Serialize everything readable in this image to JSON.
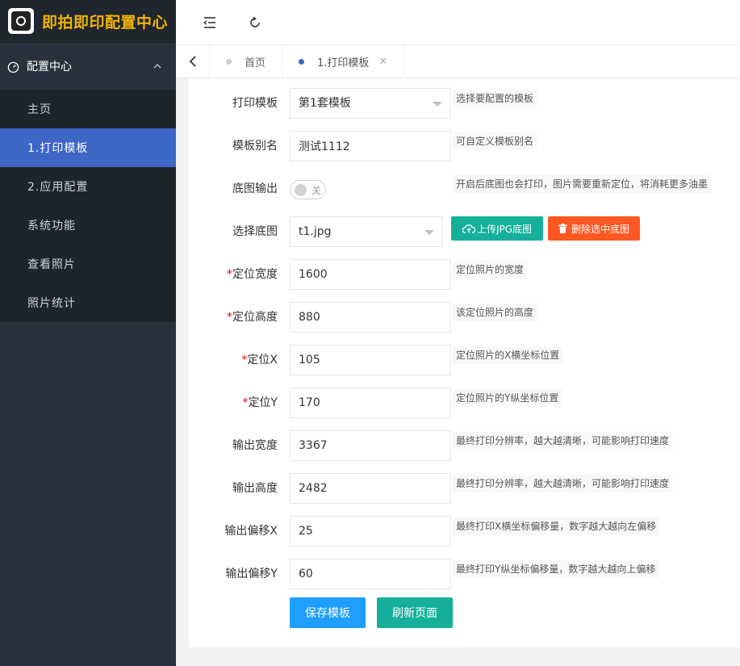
{
  "app": {
    "title": "即拍即印配置中心"
  },
  "sidebar": {
    "group_label": "配置中心",
    "items": [
      {
        "label": "主页",
        "active": false
      },
      {
        "label": "1.打印模板",
        "active": true
      },
      {
        "label": "2.应用配置",
        "active": false
      },
      {
        "label": "系统功能",
        "active": false
      },
      {
        "label": "查看照片",
        "active": false
      },
      {
        "label": "照片统计",
        "active": false
      }
    ]
  },
  "tabs": [
    {
      "label": "首页",
      "active": false
    },
    {
      "label": "1.打印模板",
      "active": true
    }
  ],
  "form": {
    "template": {
      "label": "打印模板",
      "value": "第1套模板",
      "hint": "选择要配置的模板"
    },
    "alias": {
      "label": "模板别名",
      "value": "测试1112",
      "hint": "可自定义模板别名"
    },
    "bg_output": {
      "label": "底图输出",
      "switch_text": "关",
      "hint": "开启后底图也会打印，图片需要重新定位，将消耗更多油墨"
    },
    "bg_image": {
      "label": "选择底图",
      "value": "t1.jpg",
      "upload_label": "上传JPG底图",
      "delete_label": "删除选中底图"
    },
    "pos_width": {
      "label": "定位宽度",
      "value": "1600",
      "hint": "定位照片的宽度"
    },
    "pos_height": {
      "label": "定位高度",
      "value": "880",
      "hint": "该定位照片的高度"
    },
    "pos_x": {
      "label": "定位X",
      "value": "105",
      "hint": "定位照片的X横坐标位置"
    },
    "pos_y": {
      "label": "定位Y",
      "value": "170",
      "hint": "定位照片的Y纵坐标位置"
    },
    "out_width": {
      "label": "输出宽度",
      "value": "3367",
      "hint": "最终打印分辨率，越大越清晰，可能影响打印速度"
    },
    "out_height": {
      "label": "输出高度",
      "value": "2482",
      "hint": "最终打印分辨率，越大越清晰，可能影响打印速度"
    },
    "out_offset_x": {
      "label": "输出偏移X",
      "value": "25",
      "hint": "最终打印X横坐标偏移量，数字越大越向左偏移"
    },
    "out_offset_y": {
      "label": "输出偏移Y",
      "value": "60",
      "hint": "最终打印Y纵坐标偏移量，数字越大越向上偏移"
    },
    "required_mark": "*",
    "save_label": "保存模板",
    "refresh_label": "刷新页面"
  },
  "colors": {
    "sidebar_bg": "#28323f",
    "active_item": "#3d67c7",
    "teal": "#16b09a",
    "orange": "#ff5722",
    "blue": "#1e9fff",
    "logo_text": "#f0b400"
  }
}
